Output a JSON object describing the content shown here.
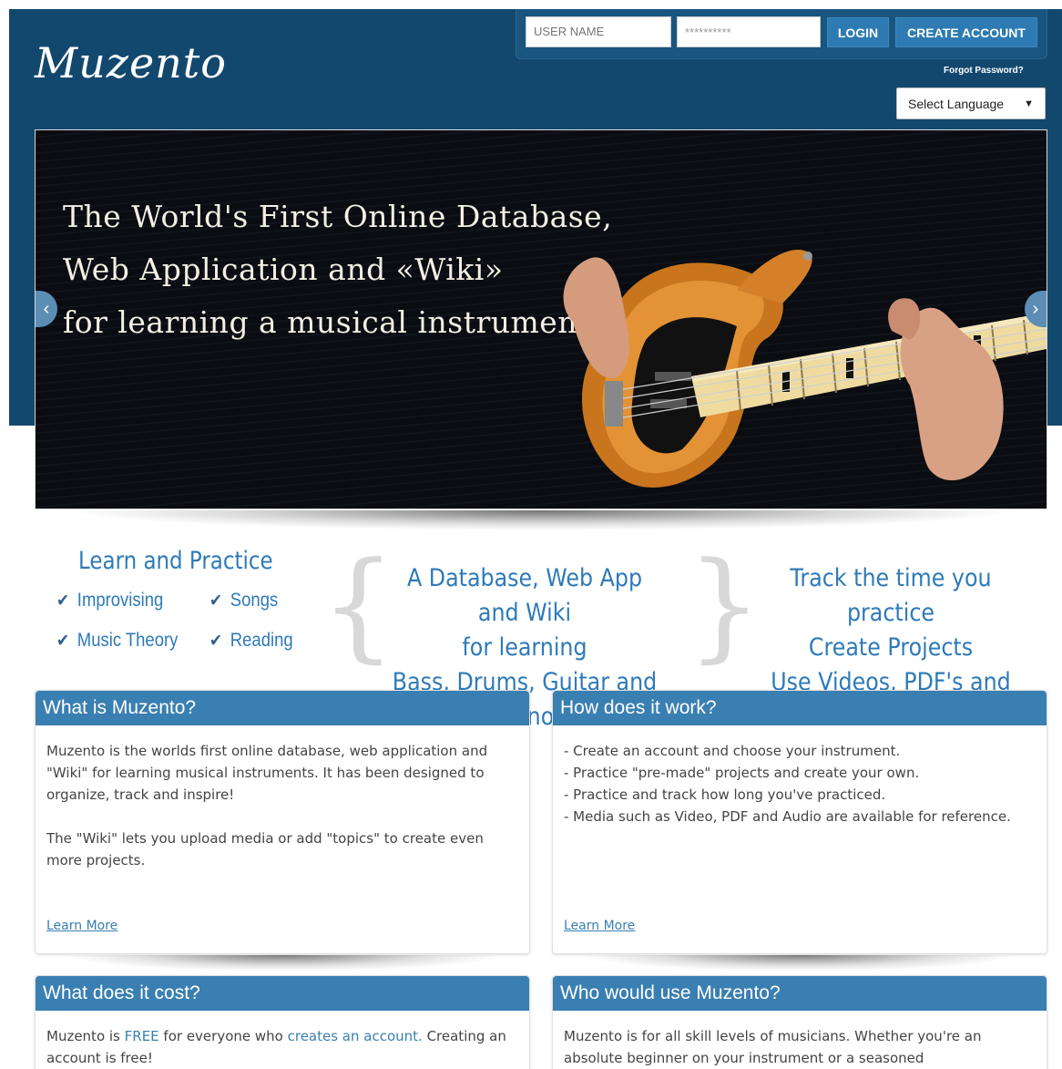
{
  "header": {
    "logo": "Muzento",
    "username_placeholder": "USER NAME",
    "password_value": "**********",
    "login_label": "LOGIN",
    "create_account_label": "CREATE ACCOUNT",
    "forgot_password": "Forgot Password?",
    "language_select": "Select Language"
  },
  "hero": {
    "line1": "The World's First Online Database,",
    "line2": "Web Application and «Wiki»",
    "line3": "for learning a musical instrument."
  },
  "features": {
    "left_title": "Learn and Practice",
    "checks": [
      "Improvising",
      "Songs",
      "Music Theory",
      "Reading"
    ],
    "center_lines": [
      "A Database, Web App and Wiki",
      "for learning",
      "Bass, Drums, Guitar and Piano"
    ],
    "right_lines": [
      "Track the time you practice",
      "Create Projects",
      "Use Videos, PDF's and Audio"
    ]
  },
  "panels": {
    "what": {
      "title": "What is Muzento?",
      "p1": "Muzento is the worlds first online database, web application and \"Wiki\" for learning musical instruments.  It has been designed to organize, track and inspire!",
      "p2": "The \"Wiki\" lets you upload media or add \"topics\" to create even more projects.",
      "link": "Learn More"
    },
    "how": {
      "title": "How does it work?",
      "items": [
        "- Create an account and choose your instrument.",
        "- Practice \"pre-made\" projects and create your own.",
        "- Practice and track how long you've practiced.",
        "- Media such as Video, PDF and Audio are available for reference."
      ],
      "link": "Learn More"
    },
    "cost": {
      "title": "What does it cost?",
      "pre": "Muzento is ",
      "free": "FREE",
      "mid": " for everyone who ",
      "create_link": "creates an account.",
      "post": "  Creating an account is free!"
    },
    "who": {
      "title": "Who would use Muzento?",
      "text": "Muzento is for all skill levels of musicians. Whether you're an absolute beginner on your instrument or a seasoned"
    }
  }
}
